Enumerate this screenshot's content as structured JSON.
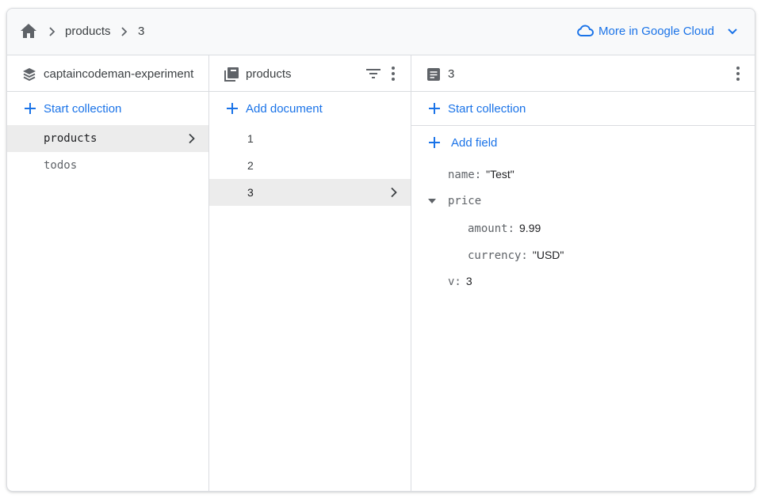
{
  "breadcrumb": {
    "home_icon": "home-icon",
    "items": [
      "products",
      "3"
    ]
  },
  "cloud_link": {
    "label": "More in Google Cloud",
    "icon": "cloud-icon"
  },
  "columns": {
    "project": {
      "title": "captaincodeman-experiment",
      "add_label": "Start collection",
      "items": [
        {
          "label": "products",
          "selected": true
        },
        {
          "label": "todos",
          "selected": false
        }
      ]
    },
    "collection": {
      "title": "products",
      "add_label": "Add document",
      "items": [
        {
          "label": "1",
          "selected": false
        },
        {
          "label": "2",
          "selected": false
        },
        {
          "label": "3",
          "selected": true
        }
      ]
    },
    "document": {
      "title": "3",
      "add_collection_label": "Start collection",
      "add_field_label": "Add field",
      "fields": [
        {
          "key": "name:",
          "value": "\"Test\""
        },
        {
          "key": "price",
          "value": ""
        },
        {
          "key": "amount:",
          "value": "9.99"
        },
        {
          "key": "currency:",
          "value": "\"USD\""
        },
        {
          "key": "v:",
          "value": "3"
        }
      ]
    }
  },
  "colors": {
    "accent": "#1a73e8",
    "selected_bg": "#ececec",
    "border": "#dadce0",
    "topbar_bg": "#f8f9fa"
  }
}
